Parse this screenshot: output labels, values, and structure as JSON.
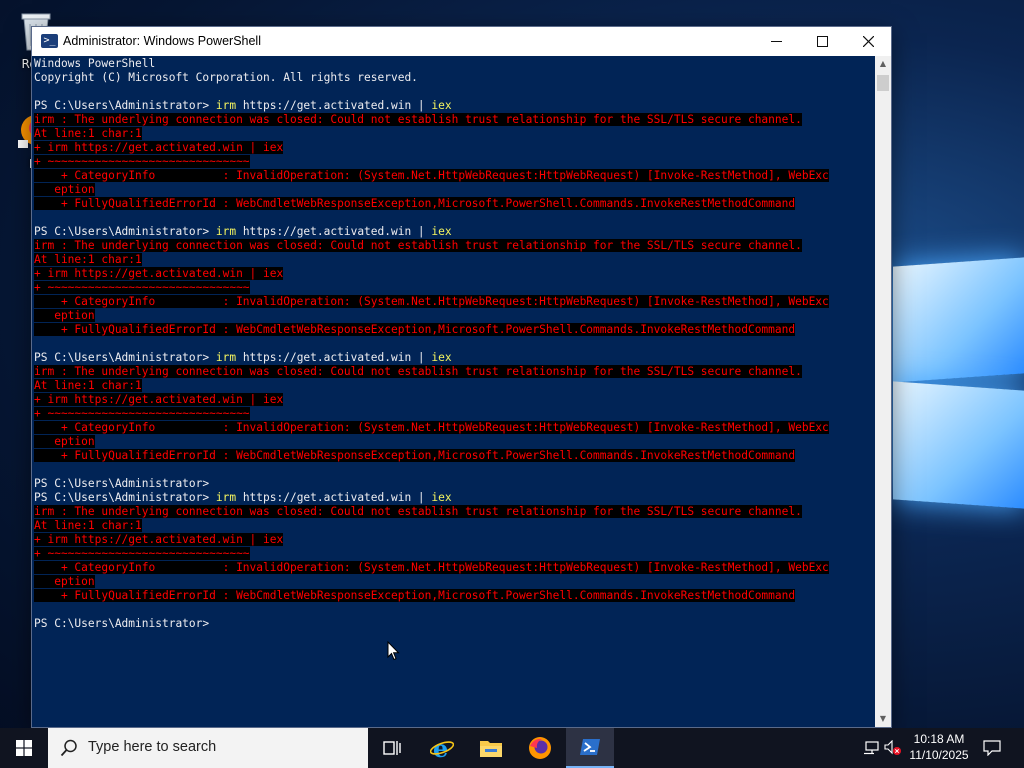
{
  "desktop": {
    "icons": [
      {
        "label": "Recycle Bin",
        "visible_label": "Recy"
      },
      {
        "label": "Firefox",
        "visible_label": "Fir"
      }
    ]
  },
  "window": {
    "title": "Administrator: Windows PowerShell",
    "controls": {
      "minimize": "minimize",
      "maximize": "maximize",
      "close": "close"
    }
  },
  "console": {
    "lines": [
      {
        "type": "white",
        "text": "Windows PowerShell"
      },
      {
        "type": "white",
        "text": "Copyright (C) Microsoft Corporation. All rights reserved."
      },
      {
        "type": "blank",
        "text": ""
      },
      {
        "type": "prompt",
        "prompt": "PS C:\\Users\\Administrator> ",
        "cmd": "irm",
        "arg": " https://get.activated.win | ",
        "cmd2": "iex"
      },
      {
        "type": "err",
        "text": "irm : The underlying connection was closed: Could not establish trust relationship for the SSL/TLS secure channel."
      },
      {
        "type": "err",
        "text": "At line:1 char:1"
      },
      {
        "type": "err",
        "text": "+ irm https://get.activated.win | iex"
      },
      {
        "type": "err",
        "text": "+ ~~~~~~~~~~~~~~~~~~~~~~~~~~~~~~"
      },
      {
        "type": "err",
        "text": "    + CategoryInfo          : InvalidOperation: (System.Net.HttpWebRequest:HttpWebRequest) [Invoke-RestMethod], WebExc"
      },
      {
        "type": "err",
        "text": "   eption"
      },
      {
        "type": "err",
        "text": "    + FullyQualifiedErrorId : WebCmdletWebResponseException,Microsoft.PowerShell.Commands.InvokeRestMethodCommand"
      },
      {
        "type": "blank",
        "text": ""
      },
      {
        "type": "prompt",
        "prompt": "PS C:\\Users\\Administrator> ",
        "cmd": "irm",
        "arg": " https://get.activated.win | ",
        "cmd2": "iex"
      },
      {
        "type": "err",
        "text": "irm : The underlying connection was closed: Could not establish trust relationship for the SSL/TLS secure channel."
      },
      {
        "type": "err",
        "text": "At line:1 char:1"
      },
      {
        "type": "err",
        "text": "+ irm https://get.activated.win | iex"
      },
      {
        "type": "err",
        "text": "+ ~~~~~~~~~~~~~~~~~~~~~~~~~~~~~~"
      },
      {
        "type": "err",
        "text": "    + CategoryInfo          : InvalidOperation: (System.Net.HttpWebRequest:HttpWebRequest) [Invoke-RestMethod], WebExc"
      },
      {
        "type": "err",
        "text": "   eption"
      },
      {
        "type": "err",
        "text": "    + FullyQualifiedErrorId : WebCmdletWebResponseException,Microsoft.PowerShell.Commands.InvokeRestMethodCommand"
      },
      {
        "type": "blank",
        "text": ""
      },
      {
        "type": "prompt",
        "prompt": "PS C:\\Users\\Administrator> ",
        "cmd": "irm",
        "arg": " https://get.activated.win | ",
        "cmd2": "iex"
      },
      {
        "type": "err",
        "text": "irm : The underlying connection was closed: Could not establish trust relationship for the SSL/TLS secure channel."
      },
      {
        "type": "err",
        "text": "At line:1 char:1"
      },
      {
        "type": "err",
        "text": "+ irm https://get.activated.win | iex"
      },
      {
        "type": "err",
        "text": "+ ~~~~~~~~~~~~~~~~~~~~~~~~~~~~~~"
      },
      {
        "type": "err",
        "text": "    + CategoryInfo          : InvalidOperation: (System.Net.HttpWebRequest:HttpWebRequest) [Invoke-RestMethod], WebExc"
      },
      {
        "type": "err",
        "text": "   eption"
      },
      {
        "type": "err",
        "text": "    + FullyQualifiedErrorId : WebCmdletWebResponseException,Microsoft.PowerShell.Commands.InvokeRestMethodCommand"
      },
      {
        "type": "blank",
        "text": ""
      },
      {
        "type": "white",
        "text": "PS C:\\Users\\Administrator>"
      },
      {
        "type": "prompt",
        "prompt": "PS C:\\Users\\Administrator> ",
        "cmd": "irm",
        "arg": " https://get.activated.win | ",
        "cmd2": "iex"
      },
      {
        "type": "err",
        "text": "irm : The underlying connection was closed: Could not establish trust relationship for the SSL/TLS secure channel."
      },
      {
        "type": "err",
        "text": "At line:1 char:1"
      },
      {
        "type": "err",
        "text": "+ irm https://get.activated.win | iex"
      },
      {
        "type": "err",
        "text": "+ ~~~~~~~~~~~~~~~~~~~~~~~~~~~~~~"
      },
      {
        "type": "err",
        "text": "    + CategoryInfo          : InvalidOperation: (System.Net.HttpWebRequest:HttpWebRequest) [Invoke-RestMethod], WebExc"
      },
      {
        "type": "err",
        "text": "   eption"
      },
      {
        "type": "err",
        "text": "    + FullyQualifiedErrorId : WebCmdletWebResponseException,Microsoft.PowerShell.Commands.InvokeRestMethodCommand"
      },
      {
        "type": "blank",
        "text": ""
      },
      {
        "type": "current",
        "text": "PS C:\\Users\\Administrator> "
      }
    ],
    "colors": {
      "background": "#012456",
      "error": "#ff0000",
      "command": "#f5f560",
      "text": "#eeedf0"
    }
  },
  "taskbar": {
    "search_placeholder": "Type here to search",
    "apps": [
      "task-view",
      "internet-explorer",
      "file-explorer",
      "firefox",
      "powershell"
    ],
    "active_app": "powershell",
    "clock": {
      "time": "10:18 AM",
      "date": "11/10/2025"
    }
  }
}
